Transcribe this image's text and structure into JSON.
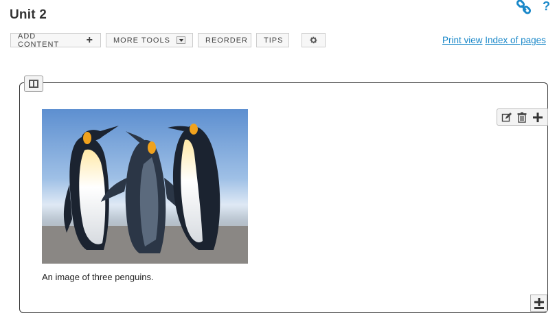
{
  "page": {
    "title": "Unit 2"
  },
  "top_icons": {
    "link_icon": "link-icon",
    "help_label": "?"
  },
  "toolbar": {
    "add_content_label": "ADD CONTENT",
    "add_content_icon": "+",
    "more_tools_label": "MORE TOOLS",
    "reorder_label": "REORDER",
    "tips_label": "TIPS",
    "settings_icon": "gear-icon"
  },
  "links": {
    "print_view": "Print view",
    "index_of_pages": "Index of pages"
  },
  "content": {
    "image_icon": "penguins-image",
    "caption": "An image of three penguins."
  },
  "item_tools": {
    "edit_icon": "edit-icon",
    "delete_icon": "trash-icon",
    "add_icon": "plus-icon"
  },
  "colors": {
    "link": "#1a88c9",
    "panel_border": "#333333"
  }
}
